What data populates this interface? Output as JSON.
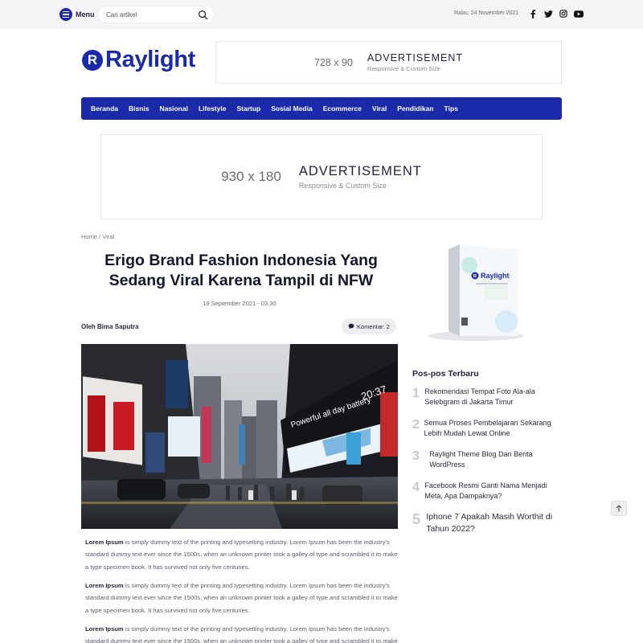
{
  "topbar": {
    "menu_label": "Menu",
    "search_placeholder": "Cari artikel",
    "date": "Rabu, 24 November 2021",
    "social": [
      "facebook-icon",
      "twitter-icon",
      "instagram-icon",
      "youtube-icon"
    ]
  },
  "header": {
    "logo_letter": "R",
    "logo_text": "Raylight",
    "ad": {
      "size": "728 x 90",
      "title": "ADVERTISEMENT",
      "subtitle": "Responsive & Custom Size"
    }
  },
  "nav": {
    "items": [
      "Beranda",
      "Bisnis",
      "Nasional",
      "Lifestyle",
      "Startup",
      "Sosial Media",
      "Ecommerce",
      "Viral",
      "Pendidikan",
      "Tips"
    ]
  },
  "banner_ad": {
    "size": "930 x 180",
    "title": "ADVERTISEMENT",
    "subtitle": "Responsive & Custom Size"
  },
  "article": {
    "breadcrumb": {
      "home": "Home",
      "separator": "/",
      "category": "Viral"
    },
    "title": "Erigo Brand Fashion Indonesia Yang Sedang Viral Karena Tampil di NFW",
    "date": "19 September 2021 - 03:30",
    "author": "Oleh Bima Saputra",
    "comments": "Komentar: 2",
    "paragraph_lead": "Lorem Ipsum",
    "paragraph_text": " is simply dummy text of the printing and typesetting industry. Lorem Ipsum has been the industry's standard dummy text ever since the 1500s, when an unknown printer took a galley of type and scrambled it to make a type specimen book. It has survived not only five centuries."
  },
  "sidebar": {
    "product_brand": "Raylight",
    "widget_title": "Pos-pos Terbaru",
    "posts": [
      {
        "num": "1",
        "title": "Rekomendasi Tempat Foto Ala-ala Selebgram di Jakarta Timur"
      },
      {
        "num": "2",
        "title": "Semua Proses Pembelajaran Sekarang Lebih Mudah Lewat Online"
      },
      {
        "num": "3",
        "title": "Raylight Theme Blog Dan Berita WordPress"
      },
      {
        "num": "4",
        "title": "Facebook Resmi Ganti Nama Menjadi Meta, Apa Dampaknya?"
      },
      {
        "num": "5",
        "title": "Iphone 7 Apakah Masih Worthit di Tahun 2022?"
      }
    ]
  },
  "colors": {
    "brand": "#1b2aa8",
    "text": "#1f2237",
    "muted": "#777777"
  }
}
